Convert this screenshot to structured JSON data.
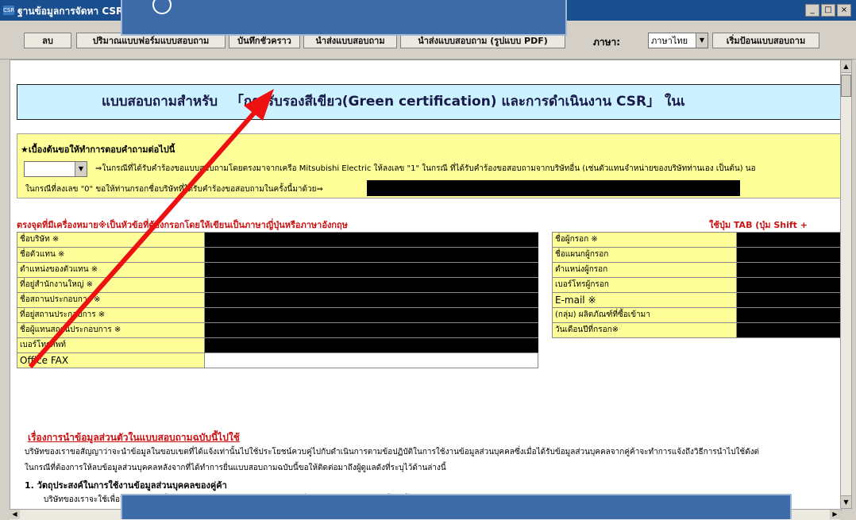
{
  "window": {
    "title": "ฐานข้อมูลการจัดหา CSR - ไ",
    "app_icon_label": "CSR",
    "min": "_",
    "max": "□",
    "close": "×"
  },
  "toolbar": {
    "delete": "ลบ",
    "form_volume": "ปริมาณแบบฟอร์มแบบสอบถาม",
    "save_temp": "บันทึกชั่วคราว",
    "import": "นำส่งแบบสอบถาม",
    "export_pdf": "นำส่งแบบสอบถาม (รูปแบบ PDF)",
    "language_label": "ภาษา:",
    "language_value": "ภาษาไทย",
    "start_input": "เริ่มป้อนแบบสอบถาม"
  },
  "header": {
    "prefix": "แบบสอบถามสำหรับ",
    "title": "「การรับรองสีเขียว(Green certification) และการดำเนินงาน CSR」 ในเ"
  },
  "notice": {
    "title": "★เบื้องต้นขอให้ทำการตอบคำถามต่อไปนี้",
    "line1": "⇒ในกรณีที่ได้รับคำร้องขอแบบสอบถามโดยตรงมาจากเครือ Mitsubishi Electric ให้ลงเลข \"1\" ในกรณี ที่ได้รับคำร้องขอสอบถามจากบริษัทอื่น (เช่นตัวแทนจำหน่ายของบริษัทท่านเอง เป็นต้น) นอ",
    "line2": "ในกรณีที่ลงเลข \"0\" ขอให้ท่านกรอกชื่อบริษัทที่ได้รับคำร้องขอสอบถามในครั้งนี้มาด้วย⇒"
  },
  "note_left": "ตรงจุดที่มีเครื่องหมาย※เป็นหัวข้อที่ต้องกรอกโดยให้เขียนเป็นภาษาญี่ปุ่นหรือภาษาอังกฤษ",
  "note_right": "ใช้ปุ่ม TAB (ปุ่ม Shift +",
  "left_fields": [
    "ชื่อบริษัท ※",
    "ชื่อตัวแทน ※",
    "ตำแหน่งของตัวแทน ※",
    "ที่อยู่สำนักงานใหญ่ ※",
    "ชื่อสถานประกอบการ ※",
    "ที่อยู่สถานประกอบการ ※",
    "ชื่อผู้แทนสถานประกอบการ ※",
    "เบอร์โทรศัพท์",
    "Office FAX"
  ],
  "right_fields": [
    "ชื่อผู้กรอก ※",
    "ชื่อแผนกผู้กรอก",
    "ตำแหน่งผู้กรอก",
    "เบอร์โทรผู้กรอก",
    "E-mail ※",
    "(กลุ่ม) ผลิตภัณฑ์ที่ซื้อเข้ามา",
    "วันเดือนปีที่กรอก※"
  ],
  "privacy": {
    "title": "เรื่องการนำข้อมูลส่วนตัวในแบบสอบถามฉบับนี้ไปใช้",
    "line1": "บริษัทของเราขอสัญญาว่าจะนำข้อมูลในขอบเขตที่ได้แจ้งเท่านั้นไปใช้ประโยชน์ควบคู่ไปกับดำเนินการตามข้อปฏิบัติในการใช้งานข้อมูลส่วนบุคคลซึ่งเมื่อได้รับข้อมูลส่วนบุคคลจากคู่ค้าจะทำการแจ้งถึงวิธีการนำไปใช้ดังต่",
    "line2": "ในกรณีที่ต้องการให้ลบข้อมูลส่วนบุคคลหลังจากที่ได้ทำการยื่นแบบสอบถามฉบับนี้ขอให้ติดต่อมาถึงผู้ดูแลดังที่ระบุไว้ด้านล่างนี้",
    "item1": "1. วัตถุประสงค์ในการใช้งานข้อมูลส่วนบุคคลของคู่ค้า",
    "item1_text": "บริษัทของเราจะใช้เพื่อยืนยันข้อมูลเนื้อหาของคำตอบและการติดต่อสอบถามเกี่ยวกับแบบสอบถามฉบับนี้เท่านั้น"
  },
  "colors": {
    "callout": "#3d6ba7",
    "arrow": "#ee1111",
    "header_band": "#ccf2ff",
    "label_bg": "#ffff99",
    "required_note": "#cc1111"
  },
  "icons": {
    "dropdown": "▼",
    "scroll_up": "▲",
    "scroll_down": "▼",
    "scroll_left": "◀",
    "scroll_right": "▶"
  }
}
